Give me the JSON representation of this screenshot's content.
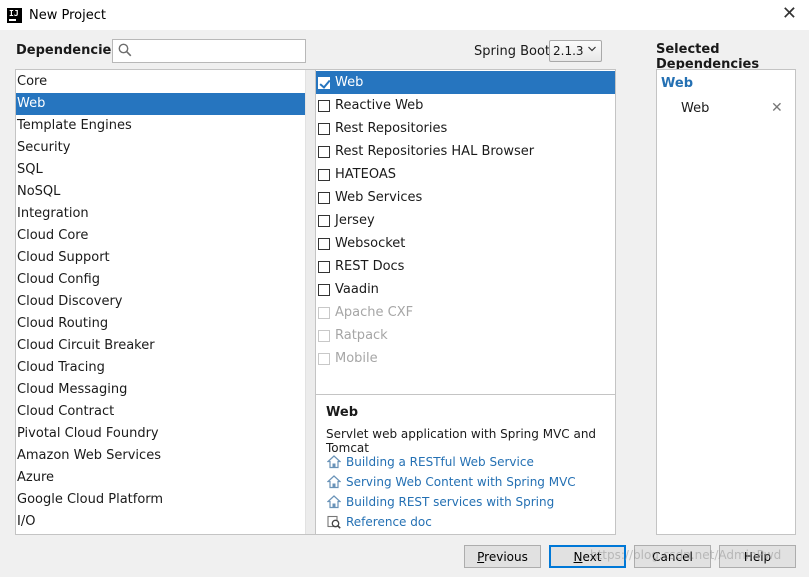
{
  "window": {
    "title": "New Project",
    "close_glyph": "✕"
  },
  "header": {
    "dependencies_label": "Dependencies",
    "search": {
      "value": "",
      "placeholder": ""
    },
    "spring_boot_label": "Spring Boot",
    "spring_boot_version": "2.1.3",
    "selected_dependencies_label": "Selected Dependencies"
  },
  "categories": [
    "Core",
    "Web",
    "Template Engines",
    "Security",
    "SQL",
    "NoSQL",
    "Integration",
    "Cloud Core",
    "Cloud Support",
    "Cloud Config",
    "Cloud Discovery",
    "Cloud Routing",
    "Cloud Circuit Breaker",
    "Cloud Tracing",
    "Cloud Messaging",
    "Cloud Contract",
    "Pivotal Cloud Foundry",
    "Amazon Web Services",
    "Azure",
    "Google Cloud Platform",
    "I/O"
  ],
  "selected_category": "Web",
  "dependencies": [
    {
      "label": "Web",
      "checked": true,
      "enabled": true,
      "selected": true
    },
    {
      "label": "Reactive Web",
      "checked": false,
      "enabled": true
    },
    {
      "label": "Rest Repositories",
      "checked": false,
      "enabled": true
    },
    {
      "label": "Rest Repositories HAL Browser",
      "checked": false,
      "enabled": true
    },
    {
      "label": "HATEOAS",
      "checked": false,
      "enabled": true
    },
    {
      "label": "Web Services",
      "checked": false,
      "enabled": true
    },
    {
      "label": "Jersey",
      "checked": false,
      "enabled": true
    },
    {
      "label": "Websocket",
      "checked": false,
      "enabled": true
    },
    {
      "label": "REST Docs",
      "checked": false,
      "enabled": true
    },
    {
      "label": "Vaadin",
      "checked": false,
      "enabled": true
    },
    {
      "label": "Apache CXF",
      "checked": false,
      "enabled": false
    },
    {
      "label": "Ratpack",
      "checked": false,
      "enabled": false
    },
    {
      "label": "Mobile",
      "checked": false,
      "enabled": false
    }
  ],
  "description": {
    "title": "Web",
    "text": "Servlet web application with Spring MVC and Tomcat",
    "links": [
      {
        "label": "Building a RESTful Web Service",
        "icon": "guide-icon"
      },
      {
        "label": "Serving Web Content with Spring MVC",
        "icon": "guide-icon"
      },
      {
        "label": "Building REST services with Spring",
        "icon": "guide-icon"
      },
      {
        "label": "Reference doc",
        "icon": "reference-doc-icon"
      }
    ]
  },
  "selected": {
    "group": "Web",
    "items": [
      "Web"
    ],
    "remove_glyph": "✕"
  },
  "buttons": {
    "previous": "Previous",
    "next": "Next",
    "cancel": "Cancel",
    "help": "Help"
  },
  "watermark": "https://blog.csdn.net/AdminPwd",
  "colors": {
    "selection": "#2675bf",
    "link": "#2470b3"
  }
}
